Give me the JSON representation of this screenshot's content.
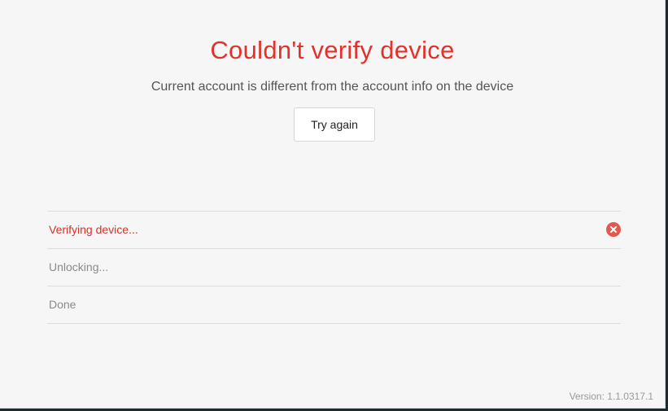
{
  "dialog": {
    "title": "Couldn't verify device",
    "message": "Current account is different from the account info on the device",
    "retry_label": "Try again"
  },
  "steps": [
    {
      "label": "Verifying device...",
      "status": "error",
      "icon": "error-x-icon"
    },
    {
      "label": "Unlocking...",
      "status": "pending"
    },
    {
      "label": "Done",
      "status": "pending"
    }
  ],
  "footer": {
    "version": "Version: 1.1.0317.1"
  },
  "colors": {
    "error": "#e0332b",
    "text_muted": "#8a8a8a",
    "background": "#f6f6f6"
  }
}
